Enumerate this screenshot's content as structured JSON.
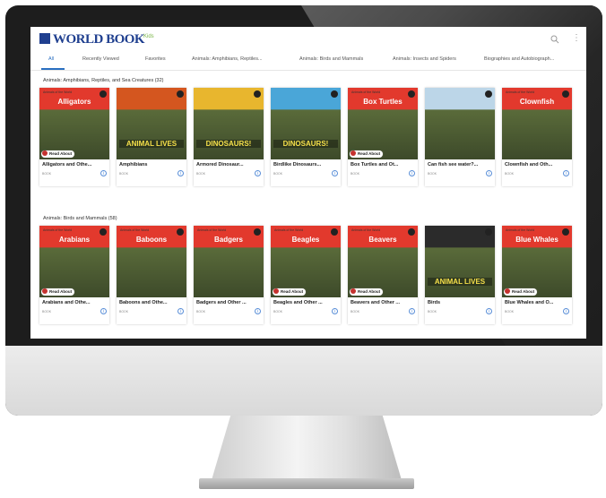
{
  "app": {
    "logo": "WORLD BOOK",
    "beta": "Kids"
  },
  "tabs": [
    {
      "label": "All"
    },
    {
      "label": "Recently Viewed"
    },
    {
      "label": "Favorites"
    },
    {
      "label": "Animals: Amphibians, Reptiles..."
    },
    {
      "label": "Animals: Birds and Mammals"
    },
    {
      "label": "Animals: Insects and Spiders"
    },
    {
      "label": "Biographies and Autobiograph..."
    }
  ],
  "sections": [
    {
      "title": "Animals: Amphibians, Reptiles, and Sea Creatures (32)",
      "cards": [
        {
          "title": "Alligators and Othe...",
          "type": "BOOK",
          "cover_text": "Alligators",
          "series": "Animals of the World",
          "badge": "Read About",
          "color": "#e2392d"
        },
        {
          "title": "Amphibians",
          "type": "BOOK",
          "cover_text": "ANIMAL LIVES",
          "series": "",
          "badge": "",
          "color": "#d4561f"
        },
        {
          "title": "Armored Dinosaur...",
          "type": "BOOK",
          "cover_text": "DINOSAURS!",
          "series": "",
          "badge": "",
          "color": "#e8b62e"
        },
        {
          "title": "Birdlike Dinosaurs...",
          "type": "BOOK",
          "cover_text": "DINOSAURS!",
          "series": "",
          "badge": "",
          "color": "#4aa6d8"
        },
        {
          "title": "Box Turtles and Ot...",
          "type": "BOOK",
          "cover_text": "Box Turtles",
          "series": "Animals of the World",
          "badge": "Read About",
          "color": "#e2392d"
        },
        {
          "title": "Can fish see water?...",
          "type": "BOOK",
          "cover_text": "",
          "series": "",
          "badge": "",
          "color": "#bcd6e8"
        },
        {
          "title": "Clownfish and Oth...",
          "type": "BOOK",
          "cover_text": "Clownfish",
          "series": "Animals of the World",
          "badge": "",
          "color": "#e2392d"
        }
      ]
    },
    {
      "title": "Animals: Birds and Mammals (58)",
      "cards": [
        {
          "title": "Arabians and Othe...",
          "type": "BOOK",
          "cover_text": "Arabians",
          "series": "Animals of the World",
          "badge": "Read About",
          "color": "#e2392d"
        },
        {
          "title": "Baboons and Othe...",
          "type": "BOOK",
          "cover_text": "Baboons",
          "series": "Animals of the World",
          "badge": "",
          "color": "#e2392d"
        },
        {
          "title": "Badgers and Other ...",
          "type": "BOOK",
          "cover_text": "Badgers",
          "series": "Animals of the World",
          "badge": "",
          "color": "#e2392d"
        },
        {
          "title": "Beagles and Other ...",
          "type": "BOOK",
          "cover_text": "Beagles",
          "series": "Animals of the World",
          "badge": "Read About",
          "color": "#e2392d"
        },
        {
          "title": "Beavers and Other ...",
          "type": "BOOK",
          "cover_text": "Beavers",
          "series": "Animals of the World",
          "badge": "Read About",
          "color": "#e2392d"
        },
        {
          "title": "Birds",
          "type": "BOOK",
          "cover_text": "ANIMAL LIVES",
          "series": "",
          "badge": "",
          "color": "#2b2b2b"
        },
        {
          "title": "Blue Whales and O...",
          "type": "BOOK",
          "cover_text": "Blue Whales",
          "series": "Animals of the World",
          "badge": "Read About",
          "color": "#e2392d"
        }
      ]
    }
  ]
}
